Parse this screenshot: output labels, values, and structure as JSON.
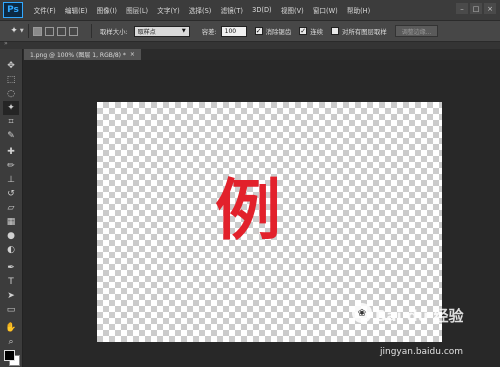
{
  "app": {
    "logo": "Ps",
    "menu": [
      "文件(F)",
      "编辑(E)",
      "图像(I)",
      "图层(L)",
      "文字(Y)",
      "选择(S)",
      "滤镜(T)",
      "3D(D)",
      "视图(V)",
      "窗口(W)",
      "帮助(H)"
    ],
    "window_controls": [
      "–",
      "□",
      "×"
    ]
  },
  "options": {
    "sample_size_label": "取样大小:",
    "sample_size_value": "取样点",
    "tolerance_label": "容差:",
    "tolerance_value": "100",
    "anti_alias_label": "消除锯齿",
    "contiguous_label": "连续",
    "all_layers_label": "对所有图层取样",
    "refine_edge_label": "调整边缘..."
  },
  "document": {
    "tab_title": "1.png @ 100% (图层 1, RGB/8) *",
    "tab_close": "×",
    "glyph": "例"
  },
  "tools": [
    {
      "name": "move-tool-icon",
      "glyph": "✥"
    },
    {
      "name": "marquee-tool-icon",
      "glyph": "⬚"
    },
    {
      "name": "lasso-tool-icon",
      "glyph": "◌"
    },
    {
      "name": "magic-wand-tool-icon",
      "glyph": "✦"
    },
    {
      "name": "crop-tool-icon",
      "glyph": "⌗"
    },
    {
      "name": "eyedropper-tool-icon",
      "glyph": "✎"
    },
    {
      "name": "healing-brush-tool-icon",
      "glyph": "✚"
    },
    {
      "name": "brush-tool-icon",
      "glyph": "✏"
    },
    {
      "name": "clone-stamp-tool-icon",
      "glyph": "⊥"
    },
    {
      "name": "history-brush-tool-icon",
      "glyph": "↺"
    },
    {
      "name": "eraser-tool-icon",
      "glyph": "▱"
    },
    {
      "name": "gradient-tool-icon",
      "glyph": "▦"
    },
    {
      "name": "blur-tool-icon",
      "glyph": "●"
    },
    {
      "name": "dodge-tool-icon",
      "glyph": "◐"
    },
    {
      "name": "pen-tool-icon",
      "glyph": "✒"
    },
    {
      "name": "type-tool-icon",
      "glyph": "T"
    },
    {
      "name": "path-selection-tool-icon",
      "glyph": "➤"
    },
    {
      "name": "shape-tool-icon",
      "glyph": "▭"
    },
    {
      "name": "hand-tool-icon",
      "glyph": "✋"
    },
    {
      "name": "zoom-tool-icon",
      "glyph": "⌕"
    }
  ],
  "watermark": {
    "text": "Bai du 经验",
    "url": "jingyan.baidu.com"
  }
}
